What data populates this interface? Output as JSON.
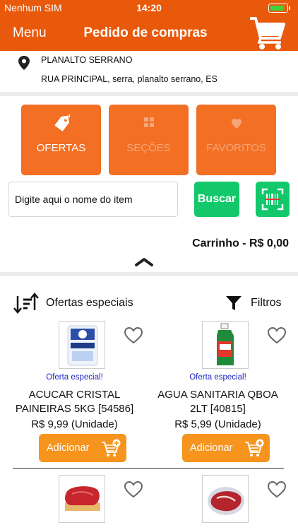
{
  "status_bar": {
    "carrier": "Nenhum SIM",
    "time": "14:20",
    "battery_icon": "battery-icon"
  },
  "header": {
    "menu_label": "Menu",
    "title": "Pedido de compras",
    "cart_icon": "cart-icon",
    "bg_color": "#e8590c"
  },
  "address": {
    "line1": "PLANALTO SERRANO",
    "line2": "RUA PRINCIPAL, serra, planalto serrano, ES"
  },
  "tabs": [
    {
      "label": "OFERTAS",
      "icon": "tag-icon",
      "active": true
    },
    {
      "label": "SEÇÕES",
      "icon": "grid-icon",
      "active": false
    },
    {
      "label": "FAVORITOS",
      "icon": "heart-icon",
      "active": false
    }
  ],
  "search": {
    "placeholder": "Digite aqui o nome do item",
    "button_label": "Buscar",
    "barcode_icon": "barcode-icon"
  },
  "cart": {
    "total_label": "Carrinho - R$ 0,00"
  },
  "list_controls": {
    "sort_label": "Ofertas especiais",
    "filter_label": "Filtros"
  },
  "products": [
    {
      "badge": "Oferta especial!",
      "name_line1": "ACUCAR CRISTAL",
      "name_line2": "PAINEIRAS 5KG [54586]",
      "price": "R$ 9,99 (Unidade)",
      "add_label": "Adicionar"
    },
    {
      "badge": "Oferta especial!",
      "name_line1": "AGUA SANITARIA QBOA",
      "name_line2": "2LT [40815]",
      "price": "R$ 5,99 (Unidade)",
      "add_label": "Adicionar"
    }
  ],
  "colors": {
    "accent": "#f26f23",
    "button_green": "#12c86a",
    "add_orange": "#f7941e",
    "offer_blue": "#1a26c4"
  }
}
